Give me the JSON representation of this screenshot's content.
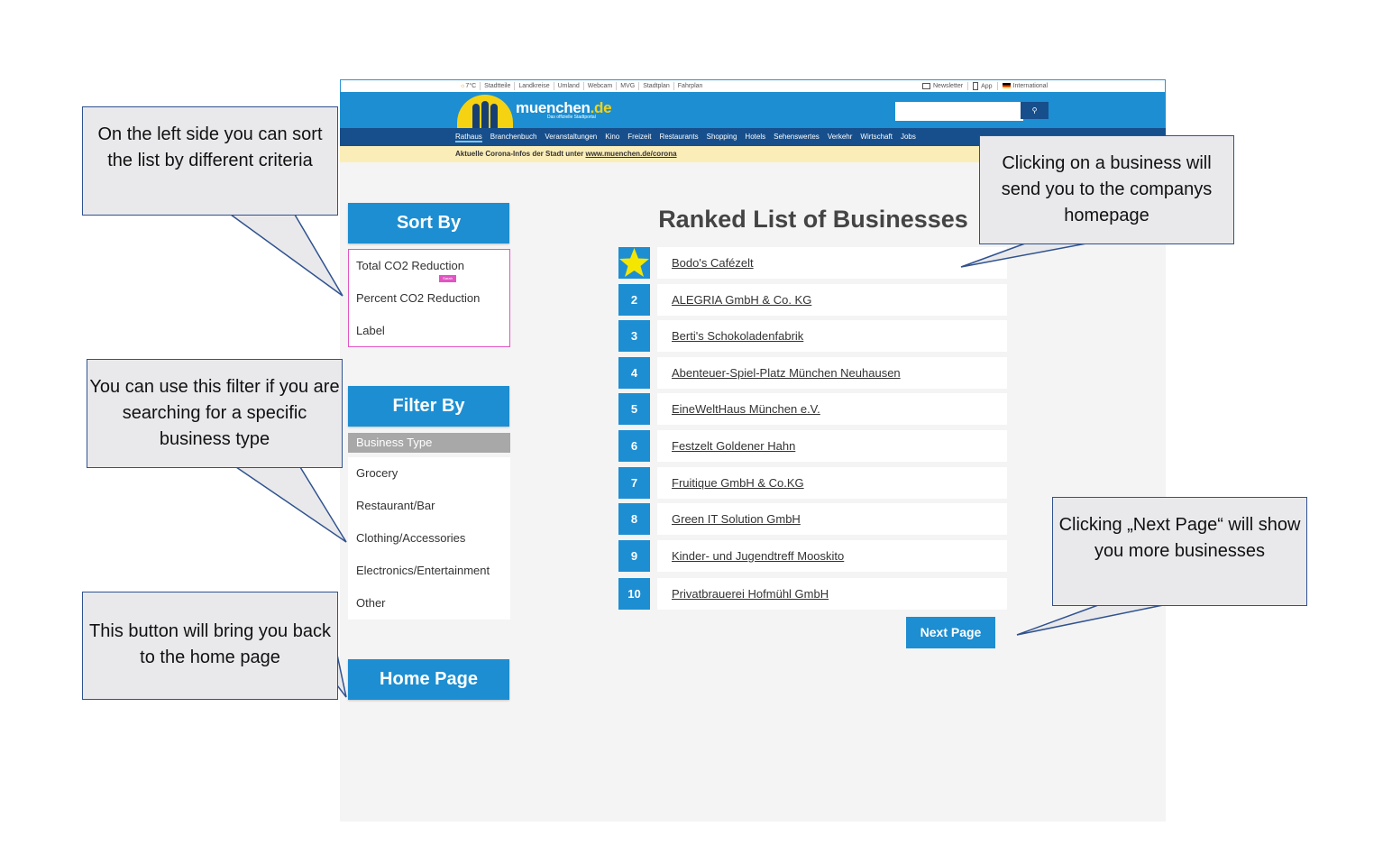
{
  "topbar": {
    "weather": "7°C",
    "links": [
      "Stadtteile",
      "Landkreise",
      "Umland",
      "Webcam",
      "MVG",
      "Stadtplan",
      "Fahrplan"
    ],
    "right_links": [
      "Newsletter",
      "App",
      "International"
    ]
  },
  "header": {
    "logo_text": "muenchen",
    "logo_tld": ".de",
    "logo_sub": "Das offizielle Stadtportal",
    "search_placeholder": "",
    "search_icon": "search-icon"
  },
  "nav": {
    "items": [
      "Rathaus",
      "Branchenbuch",
      "Veranstaltungen",
      "Kino",
      "Freizeit",
      "Restaurants",
      "Shopping",
      "Hotels",
      "Sehenswertes",
      "Verkehr",
      "Wirtschaft",
      "Jobs"
    ],
    "active": "Rathaus"
  },
  "corona": {
    "text": "Aktuelle Corona-Infos der Stadt unter",
    "link": "www.muenchen.de/corona"
  },
  "sort": {
    "title": "Sort By",
    "options": [
      "Total CO2 Reduction",
      "Percent CO2 Reduction",
      "Label"
    ],
    "cursor_tag": "Sarah"
  },
  "filter": {
    "title": "Filter By",
    "group_label": "Business Type",
    "options": [
      "Grocery",
      "Restaurant/Bar",
      "Clothing/Accessories",
      "Electronics/Entertainment",
      "Other"
    ]
  },
  "home_button": "Home Page",
  "list": {
    "title": "Ranked List of Businesses",
    "items": [
      {
        "rank": "1",
        "name": "Bodo's Cafézelt"
      },
      {
        "rank": "2",
        "name": "ALEGRIA GmbH & Co. KG "
      },
      {
        "rank": "3",
        "name": "Berti's Schokoladenfabrik"
      },
      {
        "rank": "4",
        "name": "Abenteuer-Spiel-Platz  München Neuhausen"
      },
      {
        "rank": "5",
        "name": "EineWeltHaus München e.V."
      },
      {
        "rank": "6",
        "name": "Festzelt Goldener Hahn"
      },
      {
        "rank": "7",
        "name": "Fruitique GmbH & Co.KG"
      },
      {
        "rank": "8",
        "name": "Green IT Solution GmbH"
      },
      {
        "rank": "9",
        "name": "Kinder- und Jugendtreff Mooskito"
      },
      {
        "rank": "10",
        "name": "Privatbrauerei Hofmühl GmbH"
      }
    ],
    "top_rank_icon": "star-icon",
    "next_button": "Next Page"
  },
  "callouts": {
    "sort": "On the left side you can sort the list by different criteria",
    "filter": "You can use this filter if you are searching for a specific business type",
    "home": "This button will bring you back to the home page",
    "business": "Clicking on a business will send you to the companys homepage",
    "next": "Clicking „Next Page“ will show you more businesses"
  },
  "colors": {
    "brand_blue": "#1d8ed1",
    "nav_dark": "#164f8c",
    "highlight_pink": "#e254c3",
    "star_yellow": "#f5e600"
  }
}
